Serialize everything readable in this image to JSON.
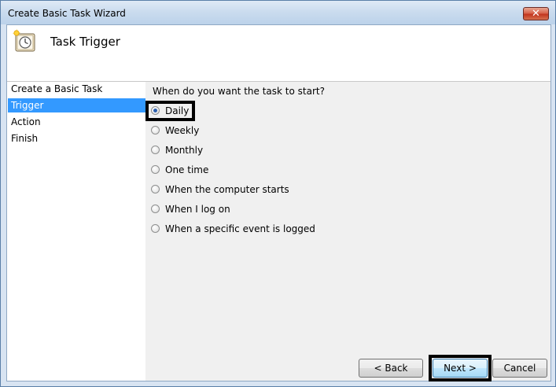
{
  "window": {
    "title": "Create Basic Task Wizard",
    "close_symbol": "✕"
  },
  "header": {
    "title": "Task Trigger",
    "icon": "task-scheduler-clock-icon"
  },
  "steps": [
    {
      "label": "Create a Basic Task",
      "selected": false
    },
    {
      "label": "Trigger",
      "selected": true
    },
    {
      "label": "Action",
      "selected": false
    },
    {
      "label": "Finish",
      "selected": false
    }
  ],
  "trigger": {
    "question": "When do you want the task to start?",
    "options": [
      {
        "label": "Daily",
        "checked": true
      },
      {
        "label": "Weekly",
        "checked": false
      },
      {
        "label": "Monthly",
        "checked": false
      },
      {
        "label": "One time",
        "checked": false
      },
      {
        "label": "When the computer starts",
        "checked": false
      },
      {
        "label": "When I log on",
        "checked": false
      },
      {
        "label": "When a specific event is logged",
        "checked": false
      }
    ]
  },
  "buttons": {
    "back": "< Back",
    "next": "Next >",
    "cancel": "Cancel"
  },
  "colors": {
    "selection": "#3399ff",
    "radio_dot": "#2b5fae",
    "close_button": "#c2361f"
  }
}
